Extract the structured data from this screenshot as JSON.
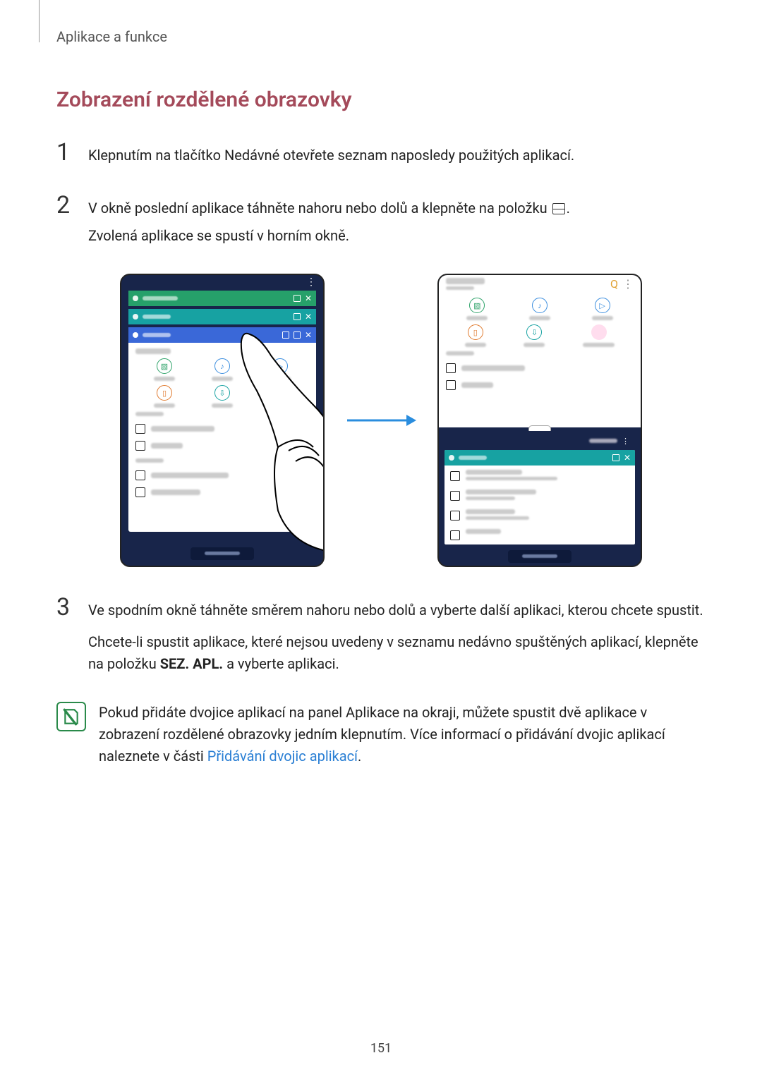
{
  "breadcrumb": "Aplikace a funkce",
  "heading": "Zobrazení rozdělené obrazovky",
  "steps": {
    "s1": {
      "num": "1",
      "text": "Klepnutím na tlačítko Nedávné otevřete seznam naposledy použitých aplikací."
    },
    "s2": {
      "num": "2",
      "line1_a": "V okně poslední aplikace táhněte nahoru nebo dolů a klepněte na položku",
      "line1_b": ".",
      "line2": "Zvolená aplikace se spustí v horním okně."
    },
    "s3": {
      "num": "3",
      "p1": "Ve spodním okně táhněte směrem nahoru nebo dolů a vyberte další aplikaci, kterou chcete spustit.",
      "p2_a": "Chcete-li spustit aplikace, které nejsou uvedeny v seznamu nedávno spuštěných aplikací, klepněte na položku ",
      "p2_bold": "SEZ. APL.",
      "p2_b": " a vyberte aplikaci."
    }
  },
  "note": {
    "text_a": "Pokud přidáte dvojice aplikací na panel Aplikace na okraji, můžete spustit dvě aplikace v zobrazení rozdělené obrazovky jedním klepnutím. Více informací o přidávání dvojic aplikací naleznete v části ",
    "link": "Přidávání dvojic aplikací",
    "text_b": "."
  },
  "icons": {
    "split_view": "split-view-icon",
    "search": "Q",
    "more": "⋮"
  },
  "page_number": "151"
}
